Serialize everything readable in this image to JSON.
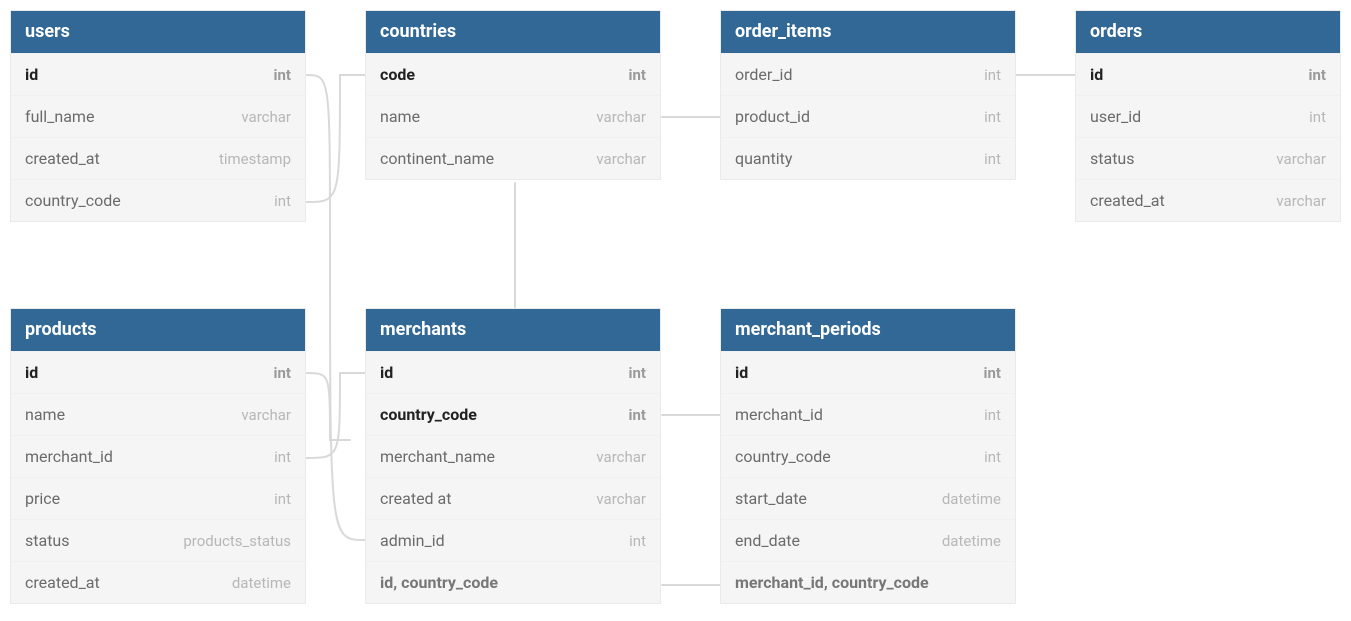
{
  "tables": {
    "users": {
      "title": "users",
      "rows": [
        {
          "name": "id",
          "type": "int",
          "bold": true
        },
        {
          "name": "full_name",
          "type": "varchar"
        },
        {
          "name": "created_at",
          "type": "timestamp"
        },
        {
          "name": "country_code",
          "type": "int"
        }
      ]
    },
    "countries": {
      "title": "countries",
      "rows": [
        {
          "name": "code",
          "type": "int",
          "bold": true
        },
        {
          "name": "name",
          "type": "varchar"
        },
        {
          "name": "continent_name",
          "type": "varchar"
        }
      ]
    },
    "order_items": {
      "title": "order_items",
      "rows": [
        {
          "name": "order_id",
          "type": "int"
        },
        {
          "name": "product_id",
          "type": "int"
        },
        {
          "name": "quantity",
          "type": "int"
        }
      ]
    },
    "orders": {
      "title": "orders",
      "rows": [
        {
          "name": "id",
          "type": "int",
          "bold": true
        },
        {
          "name": "user_id",
          "type": "int"
        },
        {
          "name": "status",
          "type": "varchar"
        },
        {
          "name": "created_at",
          "type": "varchar"
        }
      ]
    },
    "products": {
      "title": "products",
      "rows": [
        {
          "name": "id",
          "type": "int",
          "bold": true
        },
        {
          "name": "name",
          "type": "varchar"
        },
        {
          "name": "merchant_id",
          "type": "int"
        },
        {
          "name": "price",
          "type": "int"
        },
        {
          "name": "status",
          "type": "products_status"
        },
        {
          "name": "created_at",
          "type": "datetime"
        }
      ]
    },
    "merchants": {
      "title": "merchants",
      "rows": [
        {
          "name": "id",
          "type": "int",
          "bold": true
        },
        {
          "name": "country_code",
          "type": "int",
          "bold": true
        },
        {
          "name": "merchant_name",
          "type": "varchar"
        },
        {
          "name": "created at",
          "type": "varchar"
        },
        {
          "name": "admin_id",
          "type": "int"
        }
      ],
      "composite": "id, country_code"
    },
    "merchant_periods": {
      "title": "merchant_periods",
      "rows": [
        {
          "name": "id",
          "type": "int",
          "bold": true
        },
        {
          "name": "merchant_id",
          "type": "int"
        },
        {
          "name": "country_code",
          "type": "int"
        },
        {
          "name": "start_date",
          "type": "datetime"
        },
        {
          "name": "end_date",
          "type": "datetime"
        }
      ],
      "composite": "merchant_id, country_code"
    }
  }
}
